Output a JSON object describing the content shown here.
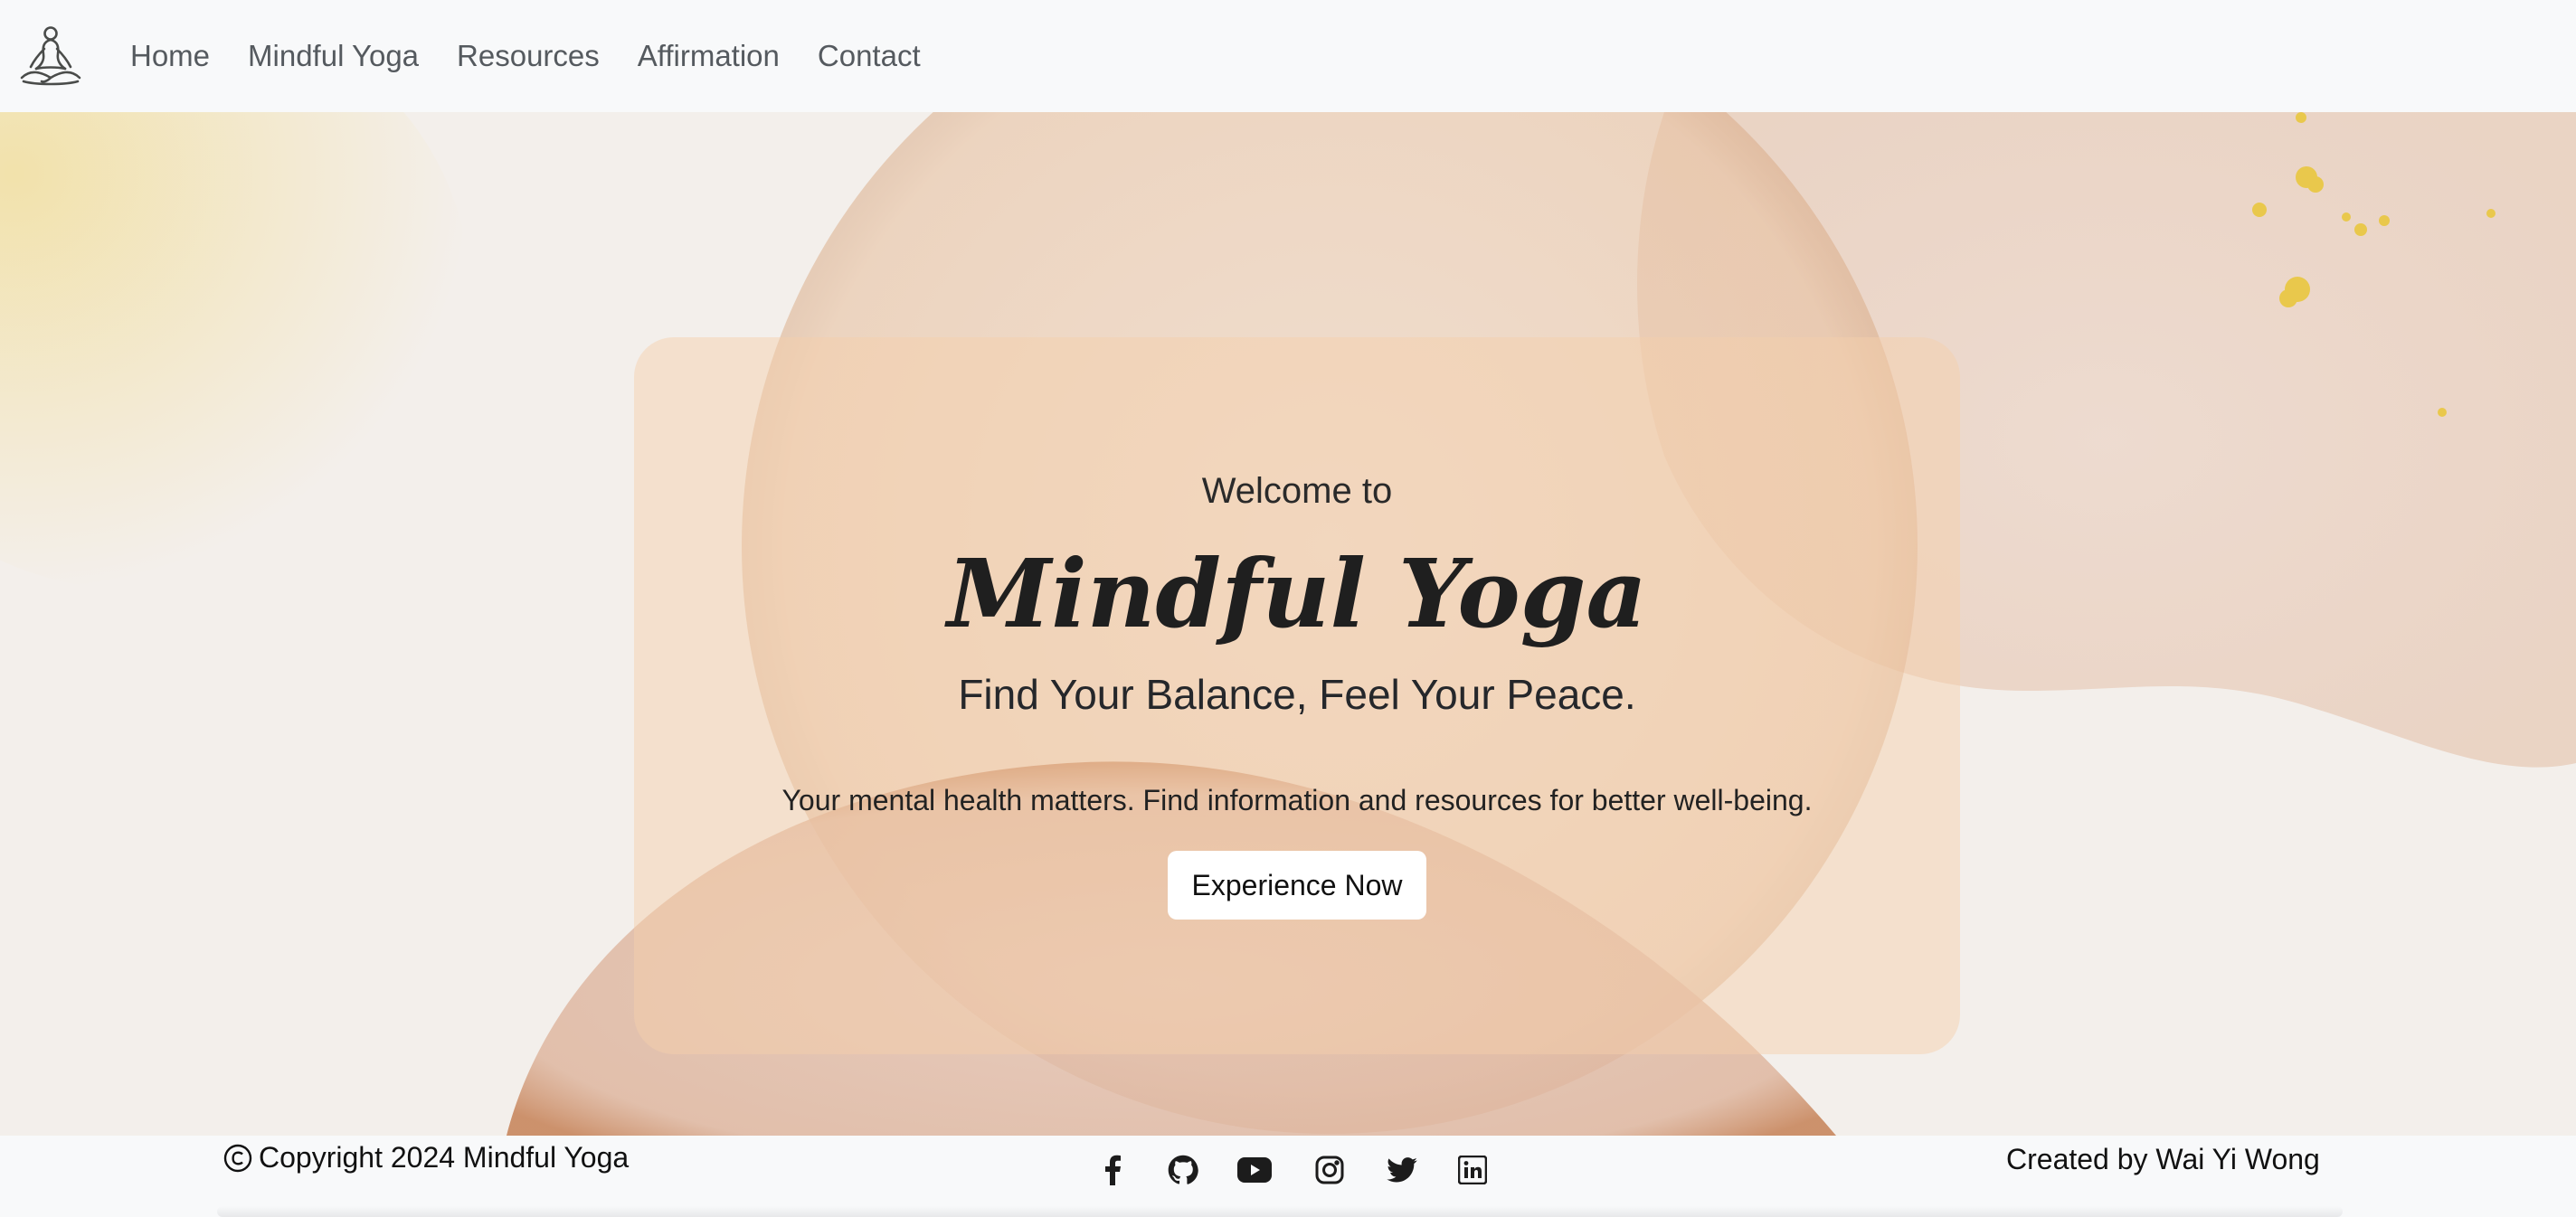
{
  "nav": {
    "logo_icon": "meditation-figure-icon",
    "links": [
      {
        "label": "Home"
      },
      {
        "label": "Mindful Yoga"
      },
      {
        "label": "Resources"
      },
      {
        "label": "Affirmation"
      },
      {
        "label": "Contact"
      }
    ]
  },
  "hero": {
    "welcome": "Welcome to",
    "brand": "Mindful Yoga",
    "tagline": "Find Your Balance, Feel Your Peace.",
    "description": "Your mental health matters. Find information and resources for better well-being.",
    "cta_label": "Experience Now"
  },
  "footer": {
    "copyright_icon": "copyright-icon",
    "copyright": "Copyright 2024 Mindful Yoga",
    "social": [
      {
        "icon": "facebook-icon"
      },
      {
        "icon": "github-icon"
      },
      {
        "icon": "youtube-icon"
      },
      {
        "icon": "instagram-icon"
      },
      {
        "icon": "twitter-icon"
      },
      {
        "icon": "linkedin-icon"
      }
    ],
    "credit": "Created by Wai Yi Wong"
  },
  "colors": {
    "navbar_bg": "#f8f9fa",
    "card_bg": "#f4ceac",
    "text_dark": "#222222",
    "nav_text": "#555a5f"
  }
}
